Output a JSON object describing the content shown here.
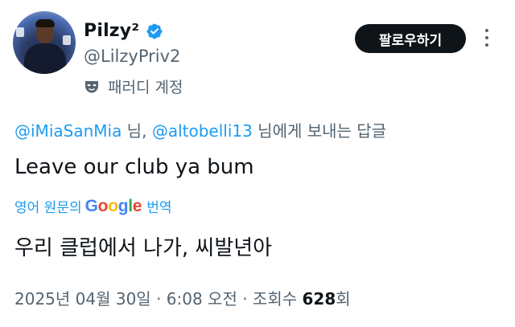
{
  "profile": {
    "display_name": "Pilzy²",
    "handle": "@LilzyPriv2",
    "parody_label": "패러디 계정",
    "verified": true
  },
  "header": {
    "follow_label": "팔로우하기"
  },
  "reply": {
    "mention1": "@iMiaSanMia",
    "sep1": " 님, ",
    "mention2": "@altobelli13",
    "suffix": " 님에게 보내는 답글"
  },
  "tweet": {
    "text": "Leave our club ya bum"
  },
  "translation": {
    "prefix": "영어 원문의",
    "brand": "Google",
    "suffix": "번역",
    "text": "우리 클럽에서 나가, 씨발년아"
  },
  "meta": {
    "timestamp": "2025년 04월 30일 · 6:08 오전 · 조회수 ",
    "views": "628",
    "views_suffix": "회"
  },
  "colors": {
    "accent": "#1d9bf0",
    "text": "#0f1419",
    "muted": "#536471",
    "button_bg": "#0f1419"
  },
  "icons": {
    "verified": "verified-badge-icon",
    "parody": "parody-mask-icon",
    "more": "more-vertical-icon"
  }
}
